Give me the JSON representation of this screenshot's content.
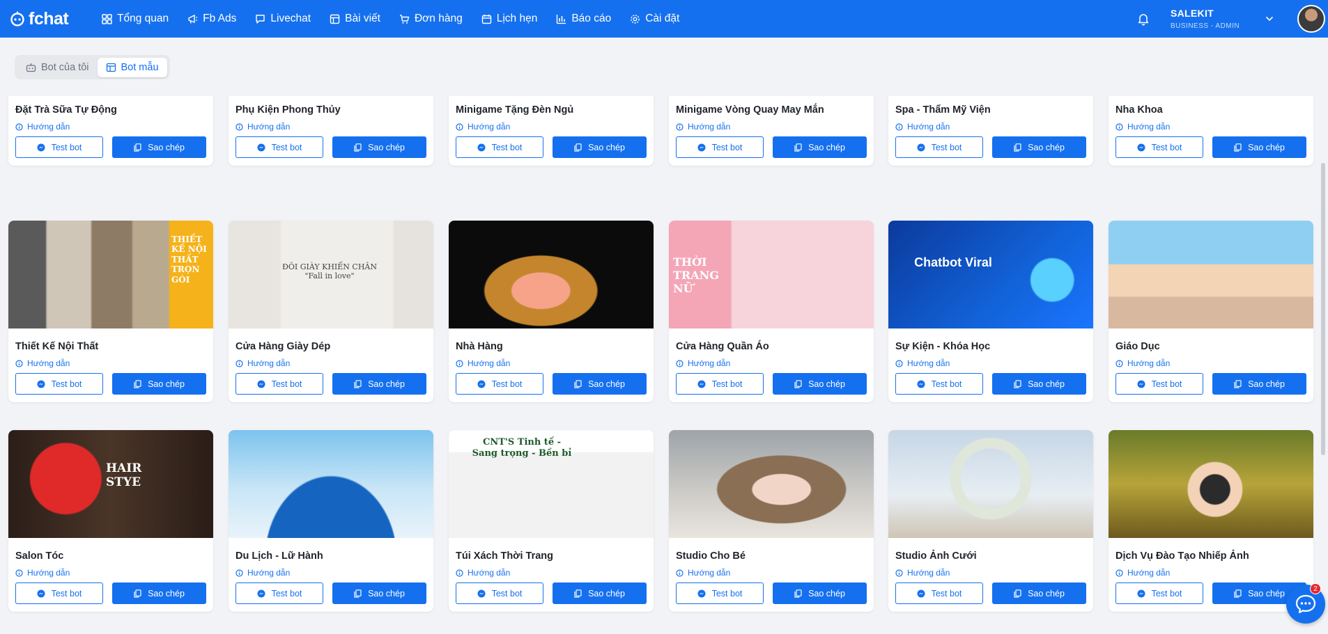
{
  "app": {
    "logo_text": "fchat",
    "nav": [
      {
        "label": "Tổng quan",
        "icon": "grid-icon"
      },
      {
        "label": "Fb Ads",
        "icon": "megaphone-icon"
      },
      {
        "label": "Livechat",
        "icon": "chat-icon"
      },
      {
        "label": "Bài viết",
        "icon": "layout-icon"
      },
      {
        "label": "Đơn hàng",
        "icon": "cart-icon"
      },
      {
        "label": "Lịch hẹn",
        "icon": "calendar-icon"
      },
      {
        "label": "Báo cáo",
        "icon": "bar-chart-icon"
      },
      {
        "label": "Cài đặt",
        "icon": "gear-icon"
      }
    ],
    "user": {
      "name": "SALEKIT",
      "role": "BUSINESS - ADMIN"
    }
  },
  "tabs": [
    {
      "label": "Bot của tôi",
      "active": false
    },
    {
      "label": "Bot mẫu",
      "active": true
    }
  ],
  "card_labels": {
    "guide": "Hướng dẫn",
    "test": "Test bot",
    "copy": "Sao chép"
  },
  "templates": [
    {
      "title": "Đặt Trà Sữa Tự Động",
      "image": "milk-tea-photo"
    },
    {
      "title": "Phụ Kiện Phong Thủy",
      "image": "zodiac-bracelet-photo"
    },
    {
      "title": "Minigame Tặng Đèn Ngủ",
      "image": "lamp-photo"
    },
    {
      "title": "Minigame Vòng Quay May Mắn",
      "image": "lucky-wheel-photo"
    },
    {
      "title": "Spa - Thẩm Mỹ Viện",
      "image": "spa-photo"
    },
    {
      "title": "Nha Khoa",
      "image": "dental-photo"
    },
    {
      "title": "Thiết Kế Nội Thất",
      "image": "interior-photo",
      "overlay": "THIẾT KẾ NỘI THẤT TRỌN GÓI"
    },
    {
      "title": "Cửa Hàng Giày Dép",
      "image": "shoes-photo",
      "overlay": "ĐÔI GIÀY KHIẾN CHÂN \"Fall in love\""
    },
    {
      "title": "Nhà Hàng",
      "image": "sashimi-photo"
    },
    {
      "title": "Cửa Hàng Quần Áo",
      "image": "fashion-photo",
      "overlay": "THỜI TRANG NỮ"
    },
    {
      "title": "Sự Kiện - Khóa Học",
      "image": "chatbot-viral-banner",
      "overlay": "Chatbot Viral"
    },
    {
      "title": "Giáo Dục",
      "image": "classroom-photo"
    },
    {
      "title": "Salon Tóc",
      "image": "hair-salon-photo",
      "overlay": "HAIR STYE"
    },
    {
      "title": "Du Lịch - Lữ Hành",
      "image": "travel-globe-photo"
    },
    {
      "title": "Túi Xách Thời Trang",
      "image": "bags-photo",
      "overlay": "CNT'S Tinh tế - Sang trọng - Bền bỉ"
    },
    {
      "title": "Studio Cho Bé",
      "image": "baby-photo"
    },
    {
      "title": "Studio Ảnh Cưới",
      "image": "wedding-photo"
    },
    {
      "title": "Dịch Vụ Đào Tạo Nhiếp Ảnh",
      "image": "photographer-photo"
    }
  ],
  "chat_badge": "2"
}
